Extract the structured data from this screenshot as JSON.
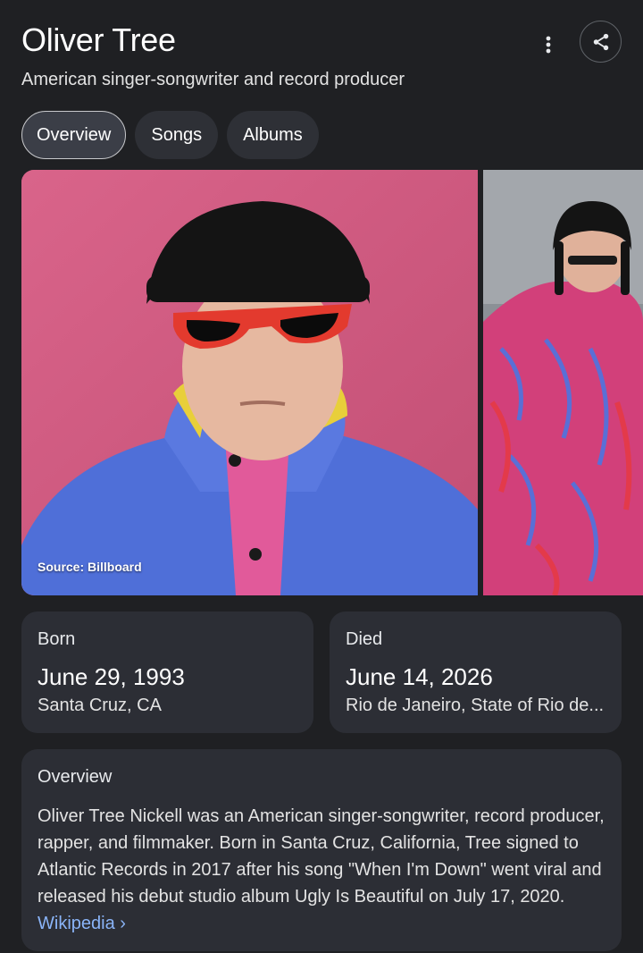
{
  "header": {
    "title": "Oliver Tree",
    "subtitle": "American singer-songwriter and record producer"
  },
  "tabs": [
    {
      "label": "Overview",
      "active": true
    },
    {
      "label": "Songs",
      "active": false
    },
    {
      "label": "Albums",
      "active": false
    }
  ],
  "images": {
    "main_source": "Source: Billboard"
  },
  "born": {
    "label": "Born",
    "date": "June 29, 1993",
    "place": "Santa Cruz, CA"
  },
  "died": {
    "label": "Died",
    "date": "June 14, 2026",
    "place": "Rio de Janeiro, State of Rio de..."
  },
  "overview": {
    "heading": "Overview",
    "text": "Oliver Tree Nickell was an American singer-songwriter, record producer, rapper, and filmmaker. Born in Santa Cruz, California, Tree signed to Atlantic Records in 2017 after his song \"When I'm Down\" went viral and released his debut studio album Ugly Is Beautiful on July 17, 2020.",
    "link_label": "Wikipedia",
    "link_chevron": "›"
  },
  "icons": {
    "more": "more-vert-icon",
    "share": "share-icon"
  },
  "colors": {
    "background": "#1f2023",
    "card": "#2c2e35",
    "link": "#8ab4f8"
  }
}
